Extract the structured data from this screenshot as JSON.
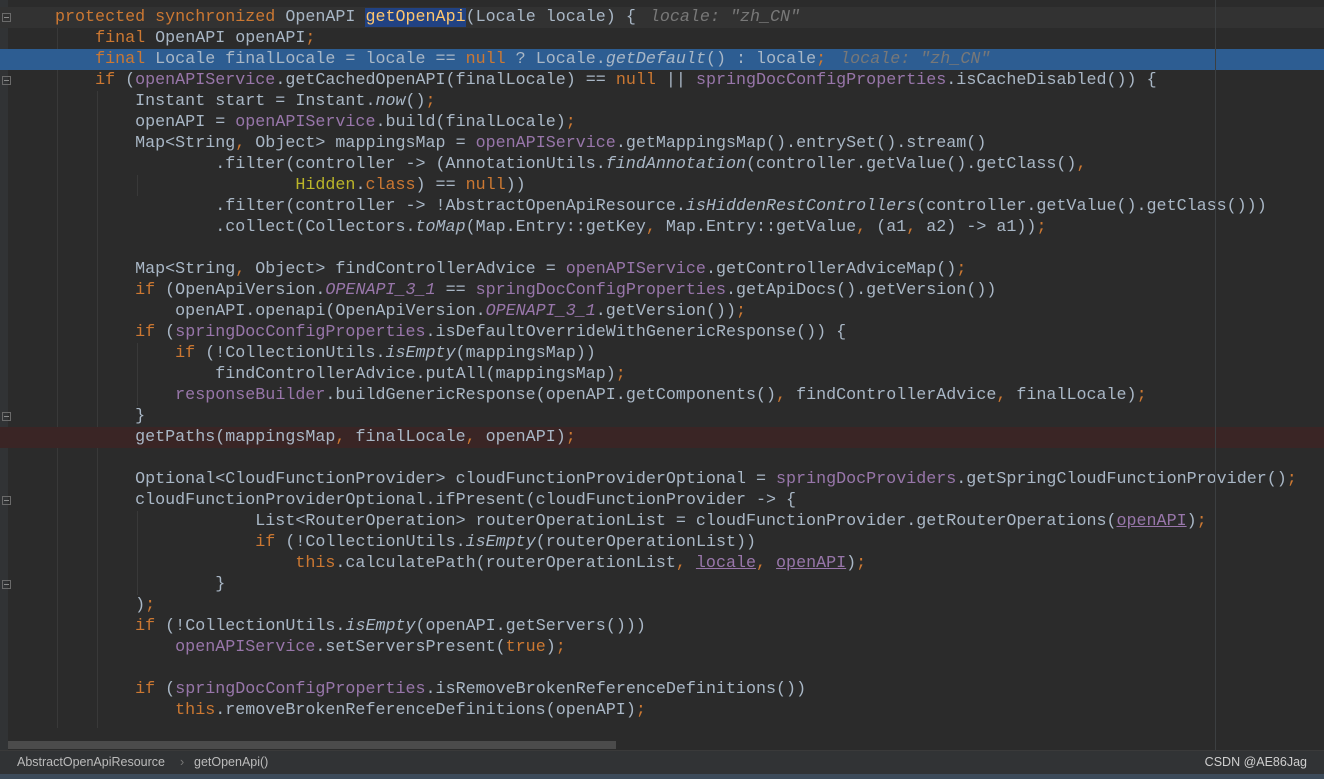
{
  "editor": {
    "lines": [
      {
        "highlight": "current",
        "fold": true,
        "tokens": [
          [
            "k",
            "protected synchronized "
          ],
          [
            "t",
            "OpenAPI "
          ],
          [
            "d",
            "getOpenApi"
          ],
          [
            "t",
            "(Locale locale) {"
          ],
          [
            "h",
            "locale: \"zh_CN\""
          ]
        ]
      },
      {
        "tokens": [
          [
            "t",
            "    "
          ],
          [
            "k",
            "final "
          ],
          [
            "t",
            "OpenAPI openAPI"
          ],
          [
            "k",
            ";"
          ]
        ]
      },
      {
        "highlight": "selection",
        "tokens": [
          [
            "t",
            "    "
          ],
          [
            "k",
            "final "
          ],
          [
            "t",
            "Locale finalLocale = locale == "
          ],
          [
            "k",
            "null"
          ],
          [
            "t",
            " ? Locale."
          ],
          [
            "i",
            "getDefault"
          ],
          [
            "t",
            "() : locale"
          ],
          [
            "k",
            ";"
          ],
          [
            "h",
            "locale: \"zh_CN\""
          ]
        ]
      },
      {
        "fold": true,
        "tokens": [
          [
            "t",
            "    "
          ],
          [
            "k",
            "if "
          ],
          [
            "t",
            "("
          ],
          [
            "p",
            "openAPIService"
          ],
          [
            "t",
            ".getCachedOpenAPI(finalLocale) == "
          ],
          [
            "k",
            "null"
          ],
          [
            "t",
            " || "
          ],
          [
            "p",
            "springDocConfigProperties"
          ],
          [
            "t",
            ".isCacheDisabled()) {"
          ]
        ]
      },
      {
        "tokens": [
          [
            "t",
            "        Instant start = Instant."
          ],
          [
            "i",
            "now"
          ],
          [
            "t",
            "()"
          ],
          [
            "k",
            ";"
          ]
        ]
      },
      {
        "tokens": [
          [
            "t",
            "        openAPI = "
          ],
          [
            "p",
            "openAPIService"
          ],
          [
            "t",
            ".build(finalLocale)"
          ],
          [
            "k",
            ";"
          ]
        ]
      },
      {
        "tokens": [
          [
            "t",
            "        Map<String"
          ],
          [
            "k",
            ", "
          ],
          [
            "t",
            "Object> mappingsMap = "
          ],
          [
            "p",
            "openAPIService"
          ],
          [
            "t",
            ".getMappingsMap().entrySet().stream()"
          ]
        ]
      },
      {
        "tokens": [
          [
            "t",
            "                .filter(controller -> (AnnotationUtils."
          ],
          [
            "i",
            "findAnnotation"
          ],
          [
            "t",
            "(controller.getValue().getClass()"
          ],
          [
            "k",
            ","
          ]
        ]
      },
      {
        "tokens": [
          [
            "t",
            "                        "
          ],
          [
            "a",
            "Hidden"
          ],
          [
            "t",
            "."
          ],
          [
            "k",
            "class"
          ],
          [
            "t",
            ") == "
          ],
          [
            "k",
            "null"
          ],
          [
            "t",
            "))"
          ]
        ]
      },
      {
        "tokens": [
          [
            "t",
            "                .filter(controller -> !AbstractOpenApiResource."
          ],
          [
            "i",
            "isHiddenRestControllers"
          ],
          [
            "t",
            "(controller.getValue().getClass()))"
          ]
        ]
      },
      {
        "tokens": [
          [
            "t",
            "                .collect(Collectors."
          ],
          [
            "i",
            "toMap"
          ],
          [
            "t",
            "(Map.Entry::getKey"
          ],
          [
            "k",
            ", "
          ],
          [
            "t",
            "Map.Entry::getValue"
          ],
          [
            "k",
            ", "
          ],
          [
            "t",
            "(a1"
          ],
          [
            "k",
            ", "
          ],
          [
            "t",
            "a2) -> a1))"
          ],
          [
            "k",
            ";"
          ]
        ]
      },
      {
        "tokens": []
      },
      {
        "tokens": [
          [
            "t",
            "        Map<String"
          ],
          [
            "k",
            ", "
          ],
          [
            "t",
            "Object> findControllerAdvice = "
          ],
          [
            "p",
            "openAPIService"
          ],
          [
            "t",
            ".getControllerAdviceMap()"
          ],
          [
            "k",
            ";"
          ]
        ]
      },
      {
        "tokens": [
          [
            "t",
            "        "
          ],
          [
            "k",
            "if "
          ],
          [
            "t",
            "(OpenApiVersion."
          ],
          [
            "pi",
            "OPENAPI_3_1"
          ],
          [
            "t",
            " == "
          ],
          [
            "p",
            "springDocConfigProperties"
          ],
          [
            "t",
            ".getApiDocs().getVersion())"
          ]
        ]
      },
      {
        "tokens": [
          [
            "t",
            "            openAPI.openapi(OpenApiVersion."
          ],
          [
            "pi",
            "OPENAPI_3_1"
          ],
          [
            "t",
            ".getVersion())"
          ],
          [
            "k",
            ";"
          ]
        ]
      },
      {
        "tokens": [
          [
            "t",
            "        "
          ],
          [
            "k",
            "if "
          ],
          [
            "t",
            "("
          ],
          [
            "p",
            "springDocConfigProperties"
          ],
          [
            "t",
            ".isDefaultOverrideWithGenericResponse()) {"
          ]
        ]
      },
      {
        "tokens": [
          [
            "t",
            "            "
          ],
          [
            "k",
            "if "
          ],
          [
            "t",
            "(!CollectionUtils."
          ],
          [
            "i",
            "isEmpty"
          ],
          [
            "t",
            "(mappingsMap))"
          ]
        ]
      },
      {
        "tokens": [
          [
            "t",
            "                findControllerAdvice.putAll(mappingsMap)"
          ],
          [
            "k",
            ";"
          ]
        ]
      },
      {
        "tokens": [
          [
            "t",
            "            "
          ],
          [
            "p",
            "responseBuilder"
          ],
          [
            "t",
            ".buildGenericResponse(openAPI.getComponents()"
          ],
          [
            "k",
            ", "
          ],
          [
            "t",
            "findControllerAdvice"
          ],
          [
            "k",
            ", "
          ],
          [
            "t",
            "finalLocale)"
          ],
          [
            "k",
            ";"
          ]
        ]
      },
      {
        "fold": true,
        "tokens": [
          [
            "t",
            "        }"
          ]
        ]
      },
      {
        "highlight": "breakpoint",
        "tokens": [
          [
            "t",
            "        getPaths(mappingsMap"
          ],
          [
            "k",
            ", "
          ],
          [
            "t",
            "finalLocale"
          ],
          [
            "k",
            ", "
          ],
          [
            "t",
            "openAPI)"
          ],
          [
            "k",
            ";"
          ]
        ]
      },
      {
        "tokens": []
      },
      {
        "tokens": [
          [
            "t",
            "        Optional<CloudFunctionProvider> cloudFunctionProviderOptional = "
          ],
          [
            "p",
            "springDocProviders"
          ],
          [
            "t",
            ".getSpringCloudFunctionProvider()"
          ],
          [
            "k",
            ";"
          ]
        ]
      },
      {
        "fold": true,
        "tokens": [
          [
            "t",
            "        cloudFunctionProviderOptional.ifPresent(cloudFunctionProvider -> {"
          ]
        ]
      },
      {
        "tokens": [
          [
            "t",
            "                    List<RouterOperation> routerOperationList = cloudFunctionProvider.getRouterOperations("
          ],
          [
            "u",
            "openAPI"
          ],
          [
            "t",
            ")"
          ],
          [
            "k",
            ";"
          ]
        ]
      },
      {
        "tokens": [
          [
            "t",
            "                    "
          ],
          [
            "k",
            "if "
          ],
          [
            "t",
            "(!CollectionUtils."
          ],
          [
            "i",
            "isEmpty"
          ],
          [
            "t",
            "(routerOperationList))"
          ]
        ]
      },
      {
        "tokens": [
          [
            "t",
            "                        "
          ],
          [
            "k",
            "this"
          ],
          [
            "t",
            ".calculatePath(routerOperationList"
          ],
          [
            "k",
            ", "
          ],
          [
            "u",
            "locale"
          ],
          [
            "k",
            ", "
          ],
          [
            "u",
            "openAPI"
          ],
          [
            "t",
            ")"
          ],
          [
            "k",
            ";"
          ]
        ]
      },
      {
        "fold": true,
        "tokens": [
          [
            "t",
            "                }"
          ]
        ]
      },
      {
        "tokens": [
          [
            "t",
            "        )"
          ],
          [
            "k",
            ";"
          ]
        ]
      },
      {
        "tokens": [
          [
            "t",
            "        "
          ],
          [
            "k",
            "if "
          ],
          [
            "t",
            "(!CollectionUtils."
          ],
          [
            "i",
            "isEmpty"
          ],
          [
            "t",
            "(openAPI.getServers()))"
          ]
        ]
      },
      {
        "tokens": [
          [
            "t",
            "            "
          ],
          [
            "p",
            "openAPIService"
          ],
          [
            "t",
            ".setServersPresent("
          ],
          [
            "k",
            "true"
          ],
          [
            "t",
            ")"
          ],
          [
            "k",
            ";"
          ]
        ]
      },
      {
        "tokens": []
      },
      {
        "tokens": [
          [
            "t",
            "        "
          ],
          [
            "k",
            "if "
          ],
          [
            "t",
            "("
          ],
          [
            "p",
            "springDocConfigProperties"
          ],
          [
            "t",
            ".isRemoveBrokenReferenceDefinitions())"
          ]
        ]
      },
      {
        "tokens": [
          [
            "t",
            "            "
          ],
          [
            "k",
            "this"
          ],
          [
            "t",
            ".removeBrokenReferenceDefinitions(openAPI)"
          ],
          [
            "k",
            ";"
          ]
        ]
      }
    ]
  },
  "breadcrumbs": {
    "items": [
      "AbstractOpenApiResource",
      "getOpenApi()"
    ],
    "separator": "›"
  },
  "watermark": "CSDN @AE86Jag",
  "colors": {
    "background": "#2b2b2b",
    "keyword": "#cc7832",
    "field": "#9876aa",
    "text": "#a9b7c6",
    "selection": "#2d5d92",
    "breakpoint_line": "#3a2525"
  }
}
